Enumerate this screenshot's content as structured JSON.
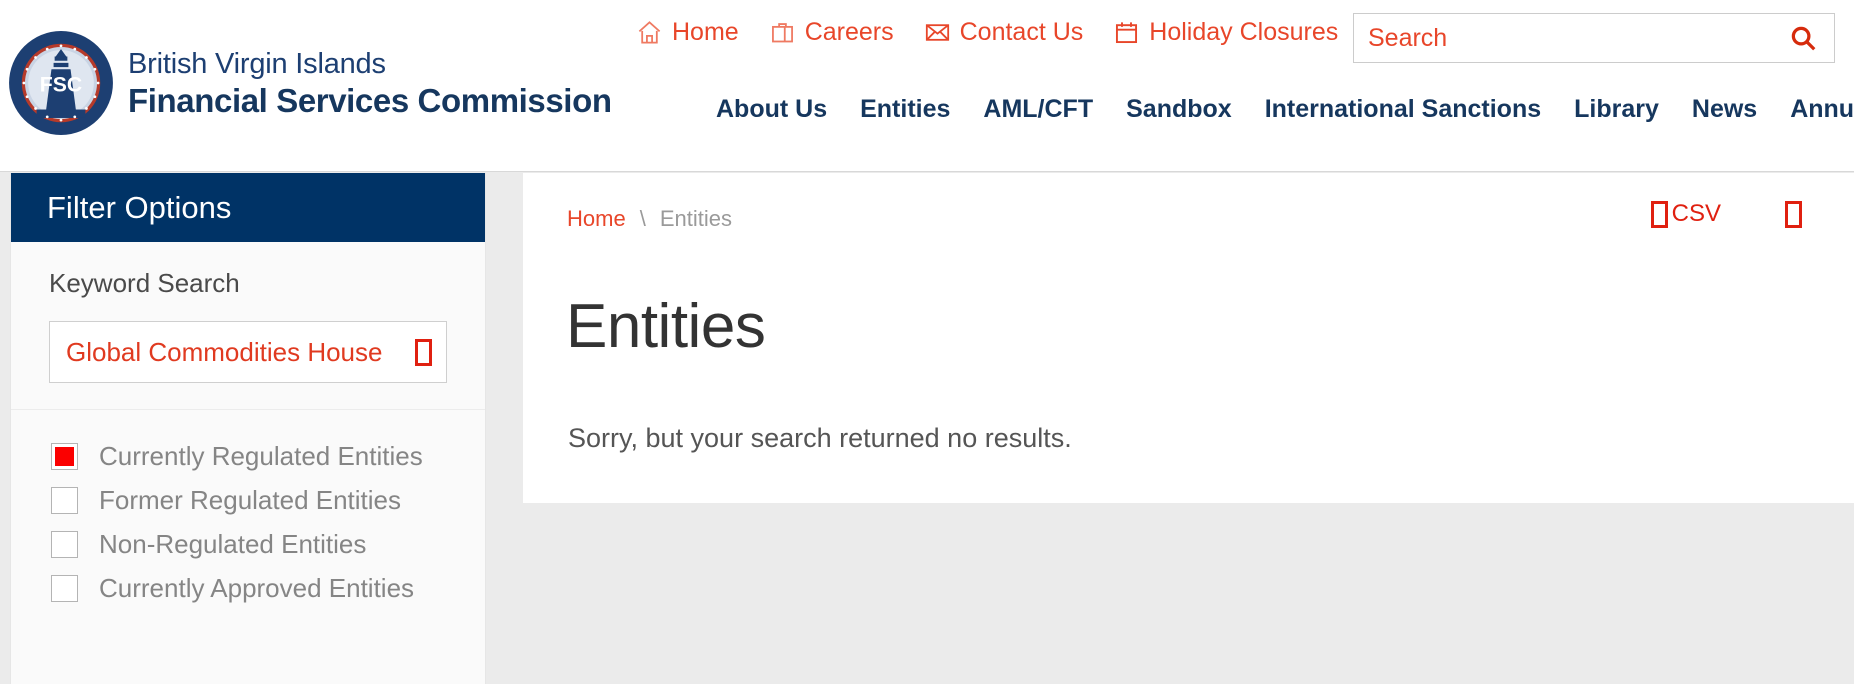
{
  "brand": {
    "line1": "British Virgin Islands",
    "line2": "Financial Services Commission",
    "seal_text_top": "BRITISH VIRGIN ISLANDS",
    "seal_text_bottom": "FINANCIAL SERVICES COMMISSION",
    "seal_monogram": "FSC",
    "navy": "#16375e",
    "accent_red": "#e8462a"
  },
  "utility_nav": [
    {
      "label": "Home",
      "icon": "home-icon"
    },
    {
      "label": "Careers",
      "icon": "briefcase-icon"
    },
    {
      "label": "Contact Us",
      "icon": "envelope-icon"
    },
    {
      "label": "Holiday Closures",
      "icon": "calendar-icon"
    }
  ],
  "search": {
    "value": "",
    "placeholder": "Search",
    "icon": "search-icon"
  },
  "main_nav": [
    {
      "label": "About Us"
    },
    {
      "label": "Entities"
    },
    {
      "label": "AML/CFT"
    },
    {
      "label": "Sandbox"
    },
    {
      "label": "International Sanctions"
    },
    {
      "label": "Library"
    },
    {
      "label": "News"
    },
    {
      "label": "Annual Returns"
    }
  ],
  "sidebar": {
    "title": "Filter Options",
    "keyword": {
      "label": "Keyword Search",
      "value": "Global Commodities House",
      "placeholder": "",
      "submit_icon": "missing-glyph-box"
    },
    "checkboxes": [
      {
        "label": "Currently Regulated Entities",
        "checked": true
      },
      {
        "label": "Former Regulated Entities",
        "checked": false
      },
      {
        "label": "Non-Regulated Entities",
        "checked": false
      },
      {
        "label": "Currently Approved Entities",
        "checked": false
      }
    ],
    "header_bg": "#003366",
    "checked_color": "#fb0000"
  },
  "breadcrumb": {
    "home": "Home",
    "separator": "\\",
    "current": "Entities"
  },
  "export": [
    {
      "label": "CSV",
      "icon": "missing-glyph-box"
    },
    {
      "label": "",
      "icon": "missing-glyph-box"
    }
  ],
  "main": {
    "title": "Entities",
    "message": "Sorry, but your search returned no results."
  }
}
